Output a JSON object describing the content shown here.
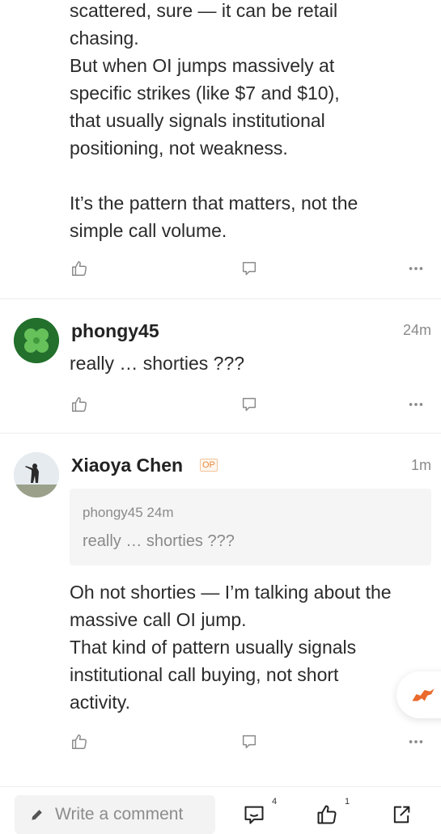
{
  "post1": {
    "body": "scattered, sure — it can be retail\nchasing.\nBut when OI jumps massively at\nspecific strikes (like $7 and $10),\nthat usually signals institutional\npositioning, not weakness.\n\nIt’s the pattern that matters, not the\nsimple call volume."
  },
  "comment1": {
    "username": "phongy45",
    "time": "24m",
    "body": "really … shorties ???"
  },
  "comment2": {
    "username": "Xiaoya Chen",
    "badge": "OP",
    "time": "1m",
    "quote": {
      "author": "phongy45",
      "time": "24m",
      "text": "really … shorties ???"
    },
    "body": "Oh not shorties — I’m talking about the\nmassive call OI jump.\nThat kind of pattern usually signals\ninstitutional call buying, not short\nactivity."
  },
  "bottom_bar": {
    "comment_placeholder": "Write a comment",
    "comment_count": "4",
    "like_count": "1"
  },
  "colors": {
    "accent": "#e8893b",
    "icon": "#8a8a8a",
    "avatar_green": "#2f9d3a"
  }
}
